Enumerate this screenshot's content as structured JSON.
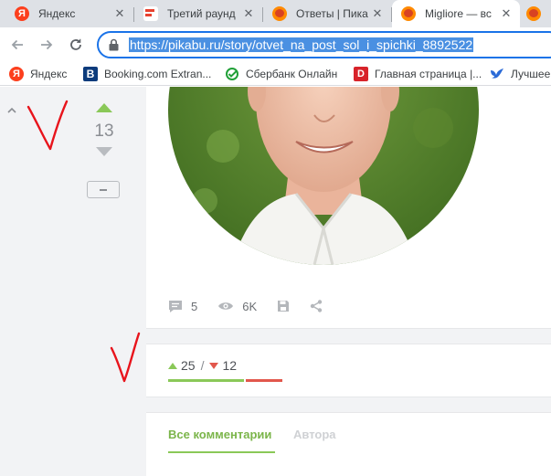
{
  "browser": {
    "tabs": [
      {
        "title": "Яндекс",
        "favicon": "yandex-icon",
        "active": false
      },
      {
        "title": "Третий раунд",
        "favicon": "document-icon",
        "active": false
      },
      {
        "title": "Ответы | Пика",
        "favicon": "pikabu-icon",
        "active": false
      },
      {
        "title": "Migliore — вс",
        "favicon": "pikabu-icon",
        "active": true
      },
      {
        "title": "",
        "favicon": "pikabu-icon",
        "active": false
      }
    ],
    "close_glyph": "✕",
    "url": "https://pikabu.ru/story/otvet_na_post_sol_i_spichki_8892522",
    "bookmarks": [
      {
        "label": "Яндекс",
        "icon": "yandex-icon"
      },
      {
        "label": "Booking.com Extran...",
        "icon": "booking-icon"
      },
      {
        "label": "Сбербанк Онлайн",
        "icon": "sberbank-icon"
      },
      {
        "label": "Главная страница |...",
        "icon": "d-icon"
      },
      {
        "label": "Лучшее",
        "icon": "bird-icon"
      }
    ]
  },
  "post": {
    "rating": "13",
    "stats": {
      "comments": "5",
      "views": "6K"
    }
  },
  "rating_summary": {
    "pluses": "25",
    "separator": "/",
    "minuses": "12"
  },
  "comments": {
    "tab_all": "Все комментарии",
    "tab_author": "Автора"
  },
  "colors": {
    "accent_green": "#8ac858",
    "accent_red": "#e2574c",
    "omnibox_focus": "#1a73e8",
    "annotation_red": "#e8141c"
  }
}
